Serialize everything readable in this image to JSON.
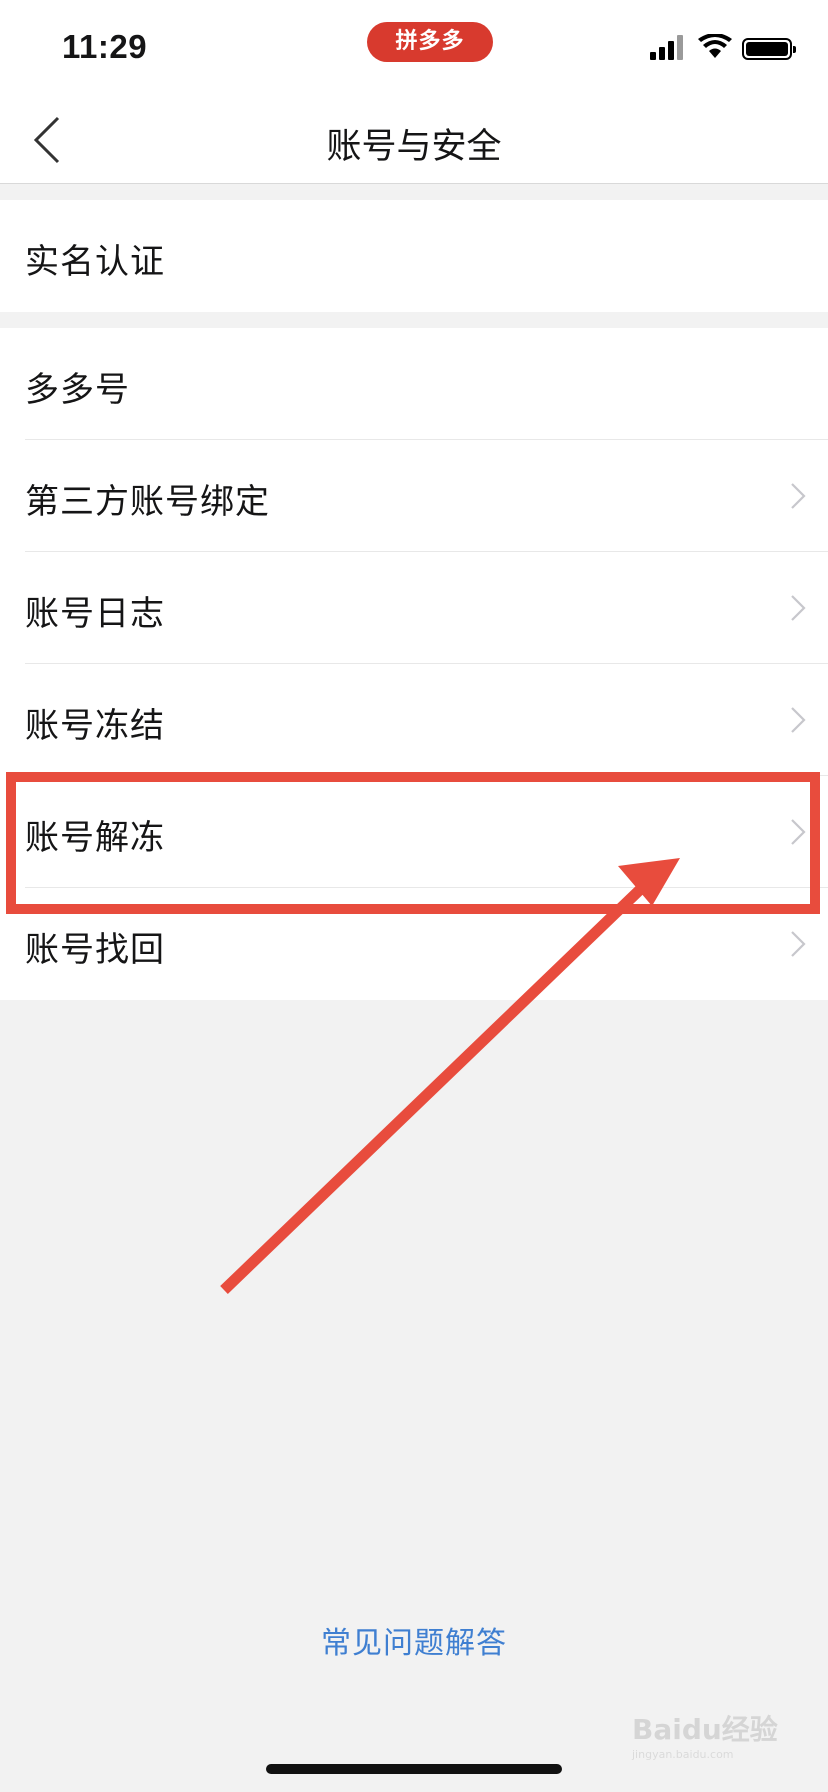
{
  "status_bar": {
    "time": "11:29",
    "app_badge": "拼多多",
    "icons": [
      "signal-icon",
      "wifi-icon",
      "battery-icon"
    ]
  },
  "nav": {
    "title": "账号与安全",
    "back_icon": "chevron-left-icon"
  },
  "groups": [
    {
      "items": [
        {
          "label": "实名认证",
          "has_chevron": false
        }
      ]
    },
    {
      "items": [
        {
          "label": "多多号",
          "has_chevron": false
        },
        {
          "label": "第三方账号绑定",
          "has_chevron": true
        },
        {
          "label": "账号日志",
          "has_chevron": true
        },
        {
          "label": "账号冻结",
          "has_chevron": true
        },
        {
          "label": "账号解冻",
          "has_chevron": true,
          "highlighted": true
        },
        {
          "label": "账号找回",
          "has_chevron": true
        }
      ]
    }
  ],
  "footer": {
    "faq_link": "常见问题解答"
  },
  "watermark": {
    "text": "Baidu经验",
    "sub": "jingyan.baidu.com"
  },
  "colors": {
    "annotation": "#e84c3d",
    "link": "#3f7fd1",
    "badge": "#d83a2e",
    "background": "#f2f2f2"
  }
}
